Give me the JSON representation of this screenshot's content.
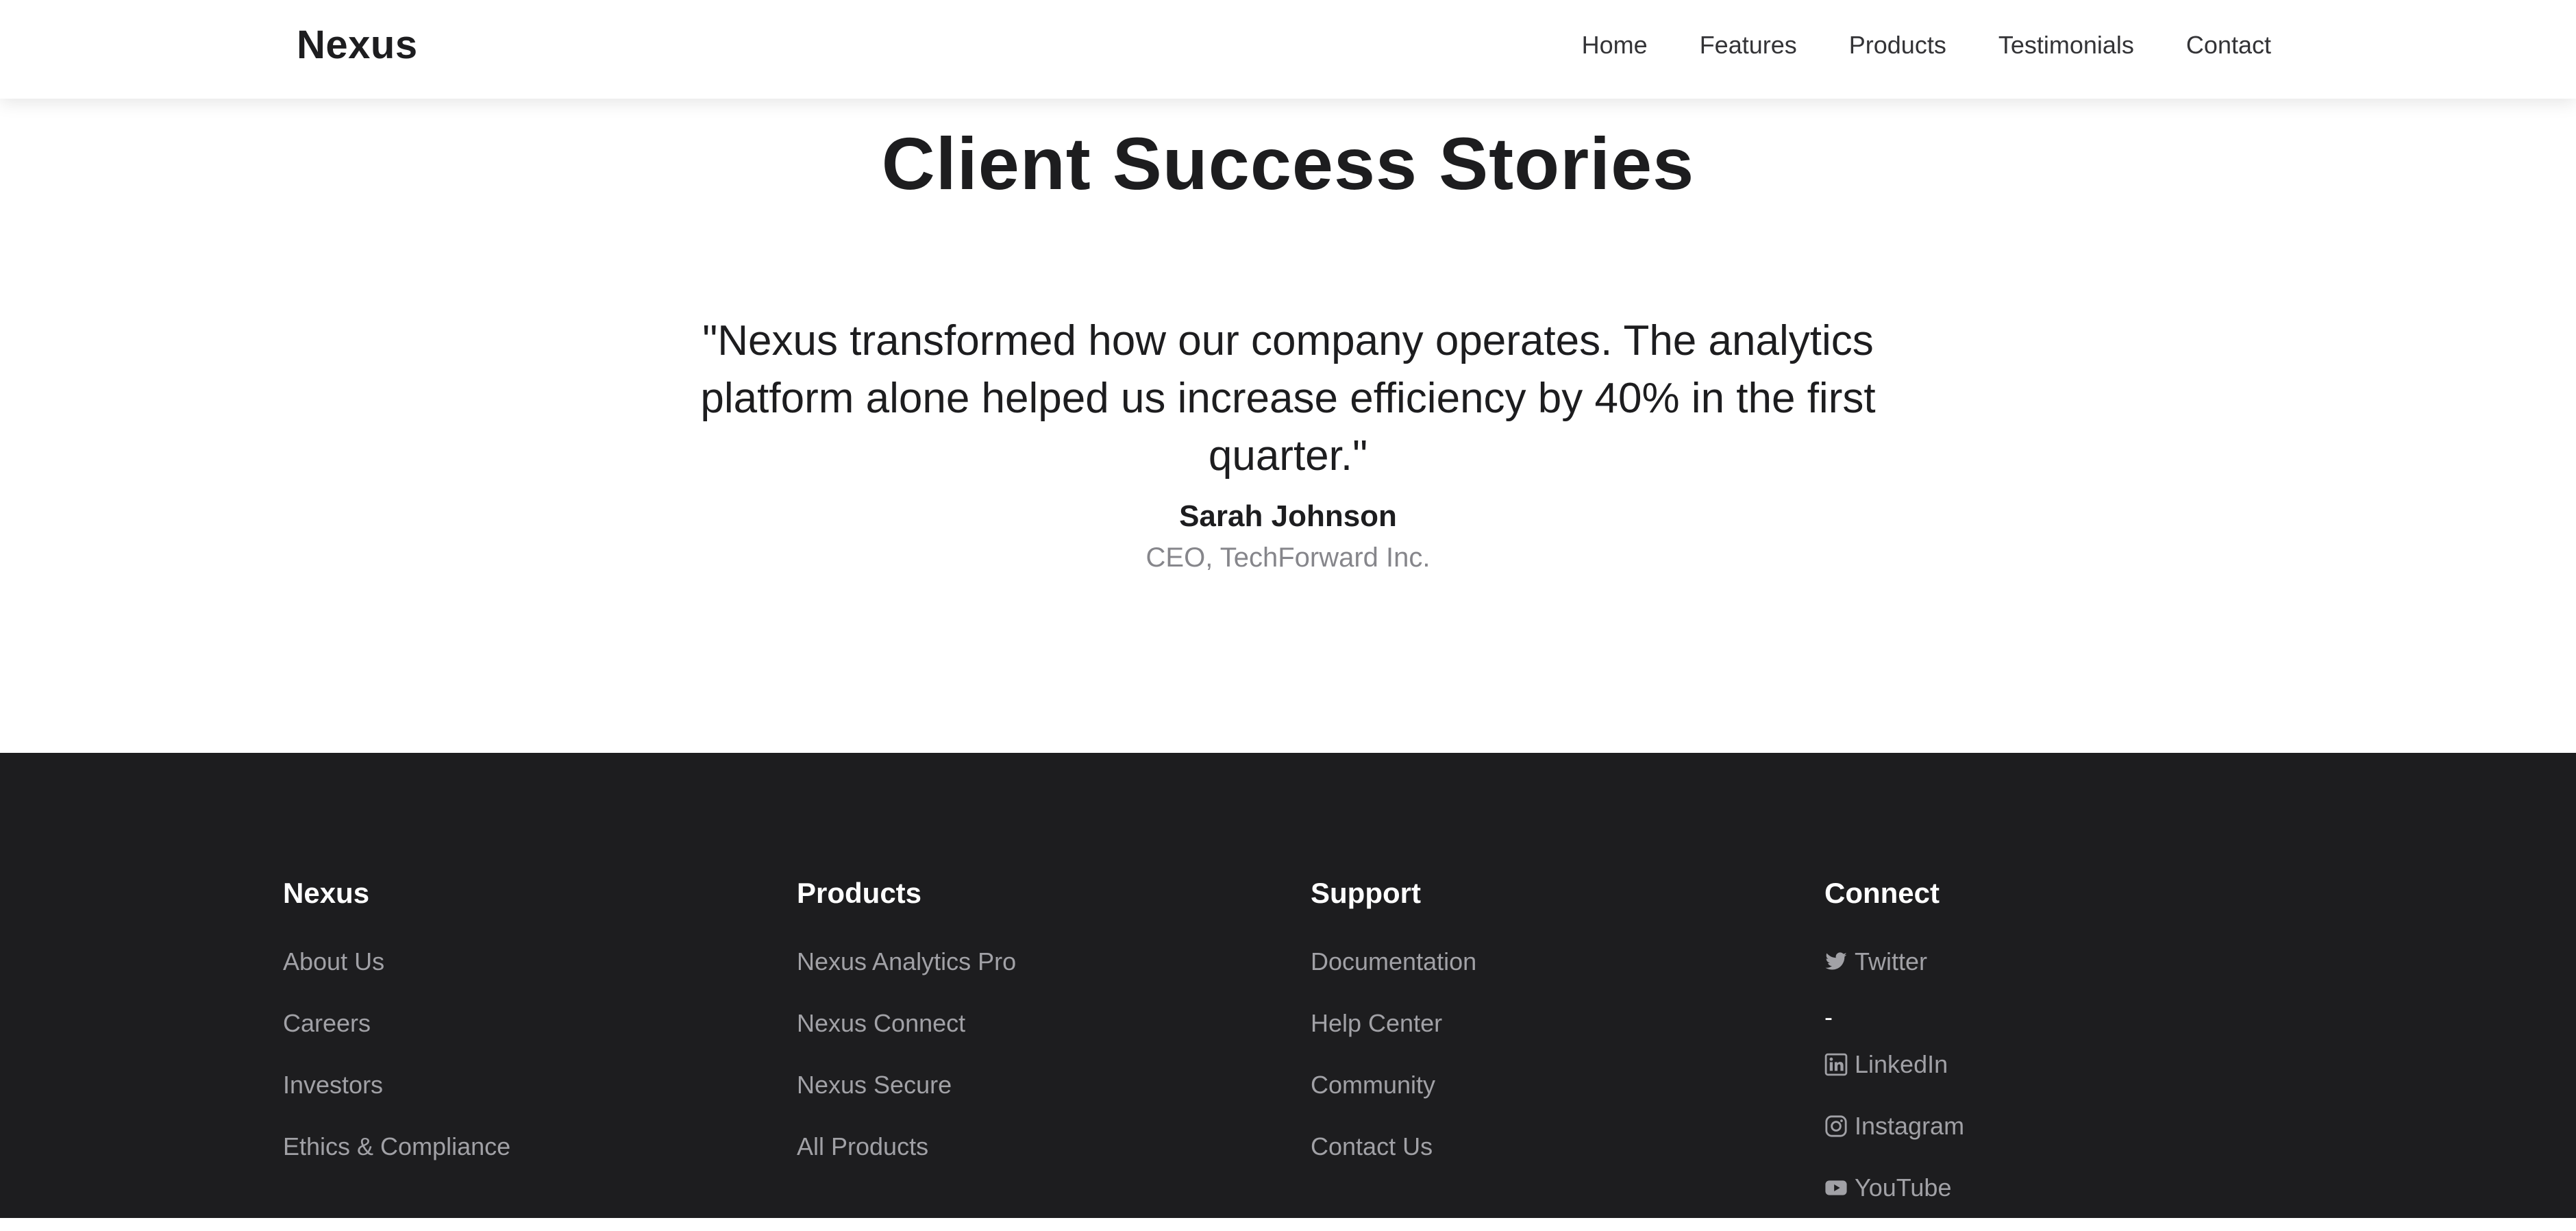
{
  "header": {
    "brand": "Nexus",
    "nav": [
      "Home",
      "Features",
      "Products",
      "Testimonials",
      "Contact"
    ]
  },
  "testimonial": {
    "title": "Client Success Stories",
    "quote": "\"Nexus transformed how our company operates. The analytics platform alone helped us increase efficiency by 40% in the first quarter.\"",
    "author_name": "Sarah Johnson",
    "author_title": "CEO, TechForward Inc."
  },
  "footer": {
    "columns": [
      {
        "heading": "Nexus",
        "links": [
          "About Us",
          "Careers",
          "Investors",
          "Ethics & Compliance"
        ]
      },
      {
        "heading": "Products",
        "links": [
          "Nexus Analytics Pro",
          "Nexus Connect",
          "Nexus Secure",
          "All Products"
        ]
      },
      {
        "heading": "Support",
        "links": [
          "Documentation",
          "Help Center",
          "Community",
          "Contact Us"
        ]
      },
      {
        "heading": "Connect",
        "separator": "-",
        "links": [
          {
            "label": "Twitter",
            "icon": "twitter-icon"
          },
          {
            "label": "LinkedIn",
            "icon": "linkedin-icon"
          },
          {
            "label": "Instagram",
            "icon": "instagram-icon"
          },
          {
            "label": "YouTube",
            "icon": "youtube-icon"
          }
        ]
      }
    ]
  },
  "colors": {
    "text_dark": "#1d1d1f",
    "text_muted": "#86868b",
    "footer_bg": "#1d1d1f",
    "footer_link": "#a1a1a6",
    "footer_heading": "#ffffff"
  }
}
